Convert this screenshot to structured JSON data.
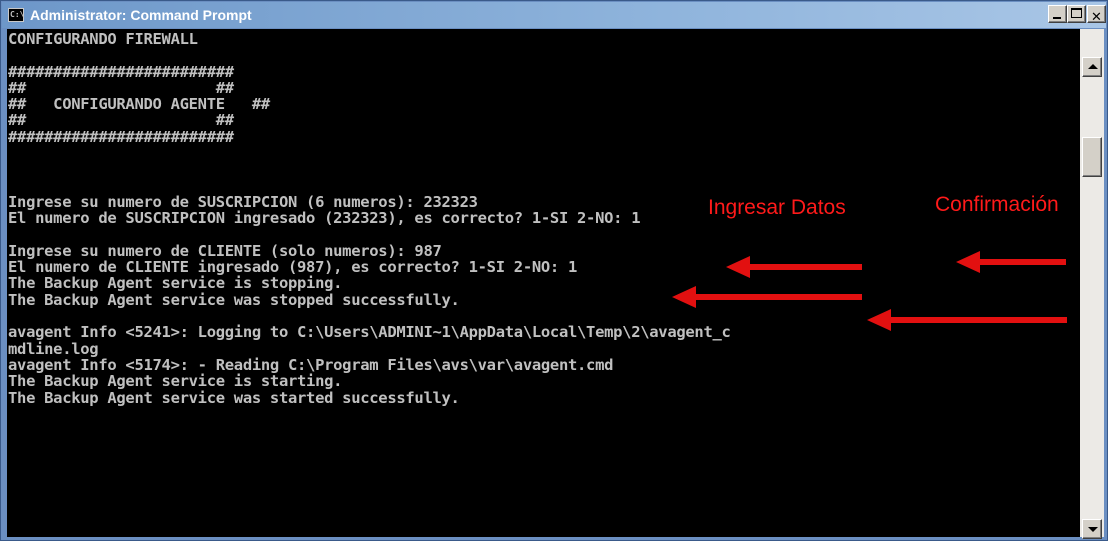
{
  "window": {
    "title": "Administrator: Command Prompt",
    "icon": "cmd-icon",
    "controls": {
      "minimize": "minimize-icon",
      "maximize": "maximize-icon",
      "close": "✕"
    }
  },
  "console": {
    "lines": [
      "CONFIGURANDO FIREWALL",
      "",
      "#########################",
      "##                     ##",
      "##   CONFIGURANDO AGENTE   ##",
      "##                     ##",
      "#########################",
      "",
      "",
      "",
      "Ingrese su numero de SUSCRIPCION (6 numeros): 232323",
      "El numero de SUSCRIPCION ingresado (232323), es correcto? 1-SI 2-NO: 1",
      "",
      "Ingrese su numero de CLIENTE (solo numeros): 987",
      "El numero de CLIENTE ingresado (987), es correcto? 1-SI 2-NO: 1",
      "The Backup Agent service is stopping.",
      "The Backup Agent service was stopped successfully.",
      "",
      "avagent Info <5241>: Logging to C:\\Users\\ADMINI~1\\AppData\\Local\\Temp\\2\\avagent_c",
      "mdline.log",
      "avagent Info <5174>: - Reading C:\\Program Files\\avs\\var\\avagent.cmd",
      "The Backup Agent service is starting.",
      "The Backup Agent service was started successfully."
    ]
  },
  "annotations": {
    "ingresar_datos": "Ingresar Datos",
    "confirmacion": "Confirmación",
    "arrow_color": "#e21010"
  },
  "colors": {
    "console_background": "#000000",
    "console_text": "#c0c0c0",
    "annotation": "#ff1a1a"
  }
}
